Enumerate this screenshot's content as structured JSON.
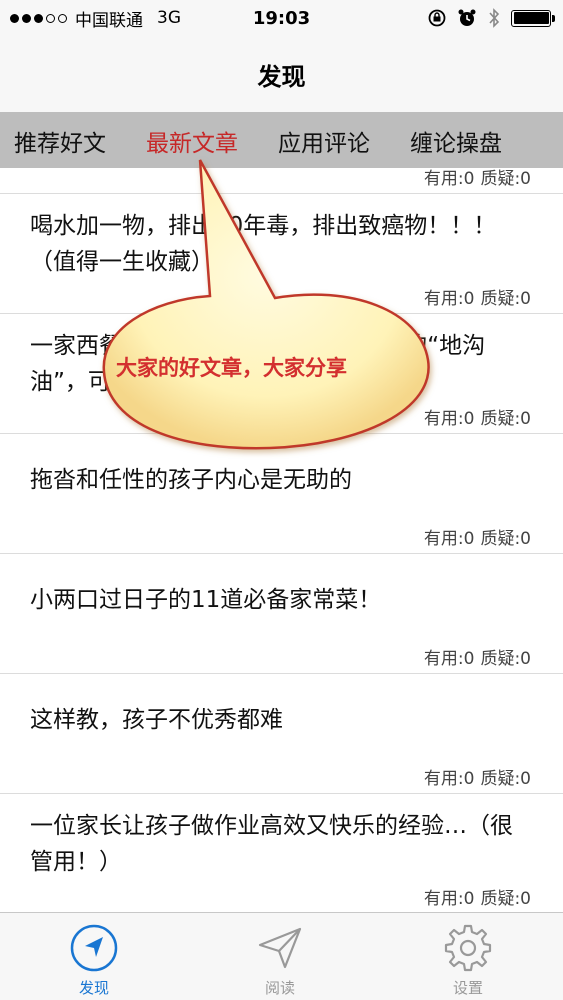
{
  "status_bar": {
    "carrier": "中国联通",
    "network": "3G",
    "time": "19:03"
  },
  "nav": {
    "title": "发现"
  },
  "tabs": [
    {
      "label": "推荐好文",
      "active": false
    },
    {
      "label": "最新文章",
      "active": true
    },
    {
      "label": "应用评论",
      "active": false
    },
    {
      "label": "缠论操盘",
      "active": false
    }
  ],
  "callout": {
    "text": "大家的好文章，大家分享"
  },
  "articles": [
    {
      "title": "",
      "meta_useful": "有用:0",
      "meta_doubt": "质疑:0"
    },
    {
      "title": "喝水加一物，排出10年毒，排出致癌物！！！（值得一生收藏）",
      "meta_useful": "有用:0",
      "meta_doubt": "质疑:0"
    },
    {
      "title": "一家西餐厅的厨师说：我吃了6、7年的“地沟油”，可能比你多见！…",
      "meta_useful": "有用:0",
      "meta_doubt": "质疑:0"
    },
    {
      "title": "拖沓和任性的孩子内心是无助的",
      "meta_useful": "有用:0",
      "meta_doubt": "质疑:0"
    },
    {
      "title": "小两口过日子的11道必备家常菜！",
      "meta_useful": "有用:0",
      "meta_doubt": "质疑:0"
    },
    {
      "title": "这样教，孩子不优秀都难",
      "meta_useful": "有用:0",
      "meta_doubt": "质疑:0"
    },
    {
      "title": "一位家长让孩子做作业高效又快乐的经验…（很管用！）",
      "meta_useful": "有用:0",
      "meta_doubt": "质疑:0"
    }
  ],
  "tab_bar": [
    {
      "label": "发现",
      "icon": "compass-icon",
      "active": true
    },
    {
      "label": "阅读",
      "icon": "paper-plane-icon",
      "active": false
    },
    {
      "label": "设置",
      "icon": "gear-icon",
      "active": false
    }
  ],
  "colors": {
    "accent_red": "#c62828",
    "tab_blue": "#1976d2",
    "tabs_bg": "#bdbdbd",
    "callout_fill": "#fff7c8"
  }
}
